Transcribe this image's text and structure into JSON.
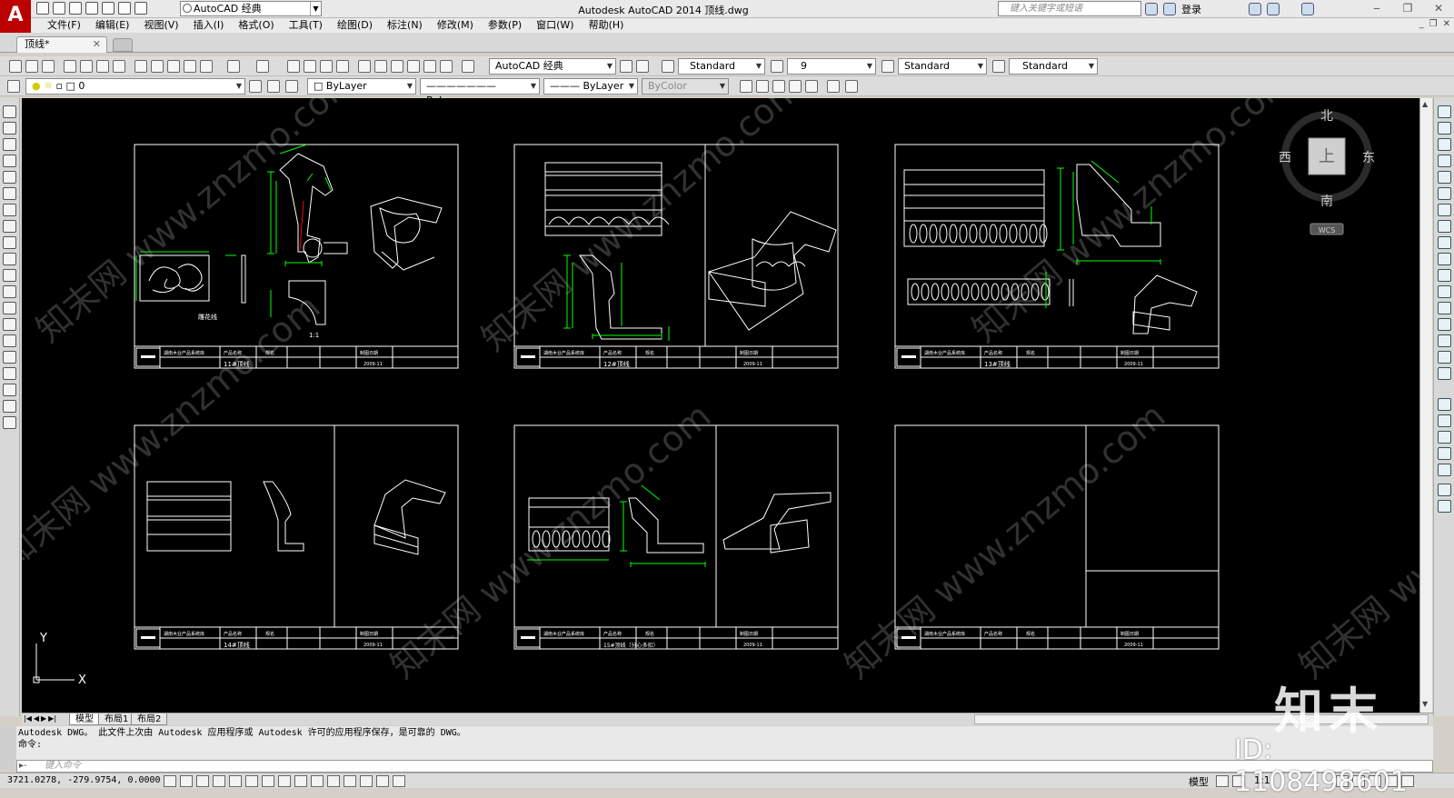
{
  "titlebar": {
    "workspace": "AutoCAD 经典",
    "window_title": "Autodesk AutoCAD 2014    顶线.dwg",
    "search_placeholder": "键入关键字或短语",
    "login": "登录"
  },
  "menu": [
    "文件(F)",
    "编辑(E)",
    "视图(V)",
    "插入(I)",
    "格式(O)",
    "工具(T)",
    "绘图(D)",
    "标注(N)",
    "修改(M)",
    "参数(P)",
    "窗口(W)",
    "帮助(H)"
  ],
  "file_tab": "顶线*",
  "toolbar1": {
    "workspace_combo": "AutoCAD 经典",
    "text_style": "Standard",
    "dim_scale": "9",
    "table_style": "Standard",
    "multileader_style": "Standard"
  },
  "toolbar2": {
    "layer": "0",
    "color": "ByLayer",
    "linetype": "ByLayer",
    "lineweight": "ByLayer",
    "plotstyle": "ByColor"
  },
  "viewcube": {
    "north": "北",
    "south": "南",
    "east": "东",
    "west": "西",
    "face": "上",
    "wcs": "WCS"
  },
  "ucs": {
    "x": "X",
    "y": "Y"
  },
  "sheets": [
    {
      "number": "11#顶线",
      "company": "湖南木业产品系统库",
      "product_label": "产品名称",
      "spec_label": "规名",
      "date_label": "制图日期",
      "date": "2009-11",
      "notes": [
        "雕花线",
        "1:1"
      ]
    },
    {
      "number": "12#顶线",
      "company": "湖南木业产品系统库",
      "product_label": "产品名称",
      "spec_label": "规名",
      "date_label": "制图日期",
      "date": "2009-11",
      "notes": []
    },
    {
      "number": "13#顶线",
      "company": "湖南木业产品系统库",
      "product_label": "产品名称",
      "spec_label": "规名",
      "date_label": "制图日期",
      "date": "2009-11",
      "notes": []
    },
    {
      "number": "14#顶线",
      "company": "湖南木业产品系统库",
      "product_label": "产品名称",
      "spec_label": "规名",
      "date_label": "制图日期",
      "date": "2009-11",
      "notes": []
    },
    {
      "number": "15#顶线（分心多扣）",
      "company": "湖南木业产品系统库",
      "product_label": "产品名称",
      "spec_label": "规名",
      "date_label": "制图日期",
      "date": "2009-11",
      "notes": []
    },
    {
      "number": "",
      "company": "湖南木业产品系统库",
      "product_label": "产品名称",
      "spec_label": "规名",
      "date_label": "制图日期",
      "date": "2009-11",
      "notes": []
    }
  ],
  "canvas_watermark": "知末网 www.znzmo.com",
  "layout_tabs": [
    "模型",
    "布局1",
    "布局2"
  ],
  "command_history": [
    "Autodesk DWG。  此文件上次由 Autodesk 应用程序或 Autodesk 许可的应用程序保存，是可靠的 DWG。",
    "命令:"
  ],
  "command_placeholder": "键入命令",
  "status": {
    "coords": "3721.0278, -279.9754, 0.0000",
    "model": "模型",
    "scale": "1:1"
  },
  "watermark": {
    "logo": "知末",
    "id": "ID: 1108498601"
  },
  "colors": {
    "canvas": "#000000",
    "line": "#ffffff",
    "dim": "#00ff00",
    "accent": "#ff0000"
  }
}
